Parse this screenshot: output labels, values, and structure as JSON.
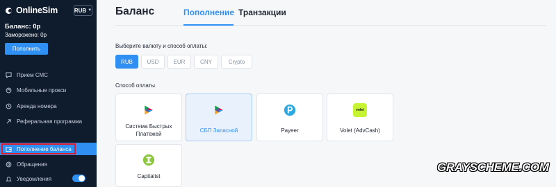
{
  "app": {
    "logo_text": "OnlineSim",
    "currency_select": "RUB"
  },
  "sidebar": {
    "balance": "Баланс: 0р",
    "frozen": "Заморожено: 0р",
    "topup_button": "Пополнить",
    "items": [
      {
        "label": "Прием СМС",
        "icon": "sms-icon"
      },
      {
        "label": "Мобильные прокси",
        "icon": "proxy-icon"
      },
      {
        "label": "Аренда номера",
        "icon": "rent-icon"
      },
      {
        "label": "Реферальная программа",
        "icon": "referral-icon"
      },
      {
        "label": "Пополнение баланса",
        "icon": "wallet-icon",
        "active": true
      },
      {
        "label": "Обращения",
        "icon": "support-icon"
      },
      {
        "label": "Уведомления",
        "icon": "bell-icon",
        "toggle": true
      }
    ]
  },
  "main": {
    "title": "Баланс",
    "tabs": [
      {
        "label": "Пополнение",
        "active": true
      },
      {
        "label": "Транзакции"
      }
    ],
    "currency_label": "Выберите валюту и способ оплаты:",
    "currencies": [
      "RUB",
      "USD",
      "EUR",
      "CNY",
      "Crypto"
    ],
    "selected_currency": "RUB",
    "method_label": "Способ оплаты",
    "methods": [
      {
        "name": "Система Быстрых Платежей",
        "line1": "Система Быстрых",
        "line2": "Платежей",
        "icon": "sbp-icon"
      },
      {
        "name": "СБП Запасной",
        "icon": "sbp-icon",
        "selected": true
      },
      {
        "name": "Payeer",
        "icon": "payeer-icon"
      },
      {
        "name": "Volet (AdvCash)",
        "icon": "volet-icon",
        "icon_text": "volet"
      },
      {
        "name": "Capitalist",
        "icon": "capitalist-icon"
      }
    ]
  },
  "watermark": "GRAYSCHEME.COM",
  "colors": {
    "accent": "#2f8ff2",
    "sidebar_bg": "#0f1c2e",
    "highlight_box": "#e11b2a"
  }
}
